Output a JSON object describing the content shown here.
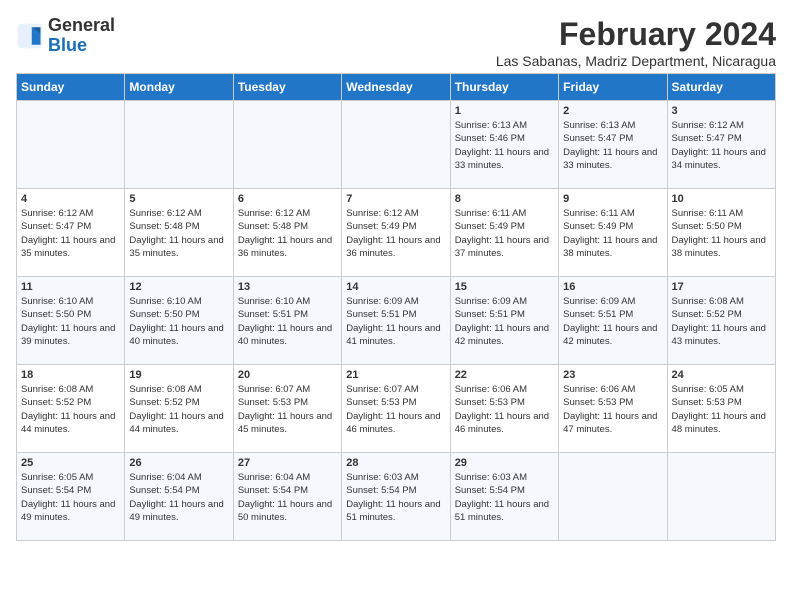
{
  "header": {
    "logo_general": "General",
    "logo_blue": "Blue",
    "month_year": "February 2024",
    "location": "Las Sabanas, Madriz Department, Nicaragua"
  },
  "columns": [
    "Sunday",
    "Monday",
    "Tuesday",
    "Wednesday",
    "Thursday",
    "Friday",
    "Saturday"
  ],
  "weeks": [
    [
      {
        "day": "",
        "info": ""
      },
      {
        "day": "",
        "info": ""
      },
      {
        "day": "",
        "info": ""
      },
      {
        "day": "",
        "info": ""
      },
      {
        "day": "1",
        "info": "Sunrise: 6:13 AM\nSunset: 5:46 PM\nDaylight: 11 hours and 33 minutes."
      },
      {
        "day": "2",
        "info": "Sunrise: 6:13 AM\nSunset: 5:47 PM\nDaylight: 11 hours and 33 minutes."
      },
      {
        "day": "3",
        "info": "Sunrise: 6:12 AM\nSunset: 5:47 PM\nDaylight: 11 hours and 34 minutes."
      }
    ],
    [
      {
        "day": "4",
        "info": "Sunrise: 6:12 AM\nSunset: 5:47 PM\nDaylight: 11 hours and 35 minutes."
      },
      {
        "day": "5",
        "info": "Sunrise: 6:12 AM\nSunset: 5:48 PM\nDaylight: 11 hours and 35 minutes."
      },
      {
        "day": "6",
        "info": "Sunrise: 6:12 AM\nSunset: 5:48 PM\nDaylight: 11 hours and 36 minutes."
      },
      {
        "day": "7",
        "info": "Sunrise: 6:12 AM\nSunset: 5:49 PM\nDaylight: 11 hours and 36 minutes."
      },
      {
        "day": "8",
        "info": "Sunrise: 6:11 AM\nSunset: 5:49 PM\nDaylight: 11 hours and 37 minutes."
      },
      {
        "day": "9",
        "info": "Sunrise: 6:11 AM\nSunset: 5:49 PM\nDaylight: 11 hours and 38 minutes."
      },
      {
        "day": "10",
        "info": "Sunrise: 6:11 AM\nSunset: 5:50 PM\nDaylight: 11 hours and 38 minutes."
      }
    ],
    [
      {
        "day": "11",
        "info": "Sunrise: 6:10 AM\nSunset: 5:50 PM\nDaylight: 11 hours and 39 minutes."
      },
      {
        "day": "12",
        "info": "Sunrise: 6:10 AM\nSunset: 5:50 PM\nDaylight: 11 hours and 40 minutes."
      },
      {
        "day": "13",
        "info": "Sunrise: 6:10 AM\nSunset: 5:51 PM\nDaylight: 11 hours and 40 minutes."
      },
      {
        "day": "14",
        "info": "Sunrise: 6:09 AM\nSunset: 5:51 PM\nDaylight: 11 hours and 41 minutes."
      },
      {
        "day": "15",
        "info": "Sunrise: 6:09 AM\nSunset: 5:51 PM\nDaylight: 11 hours and 42 minutes."
      },
      {
        "day": "16",
        "info": "Sunrise: 6:09 AM\nSunset: 5:51 PM\nDaylight: 11 hours and 42 minutes."
      },
      {
        "day": "17",
        "info": "Sunrise: 6:08 AM\nSunset: 5:52 PM\nDaylight: 11 hours and 43 minutes."
      }
    ],
    [
      {
        "day": "18",
        "info": "Sunrise: 6:08 AM\nSunset: 5:52 PM\nDaylight: 11 hours and 44 minutes."
      },
      {
        "day": "19",
        "info": "Sunrise: 6:08 AM\nSunset: 5:52 PM\nDaylight: 11 hours and 44 minutes."
      },
      {
        "day": "20",
        "info": "Sunrise: 6:07 AM\nSunset: 5:53 PM\nDaylight: 11 hours and 45 minutes."
      },
      {
        "day": "21",
        "info": "Sunrise: 6:07 AM\nSunset: 5:53 PM\nDaylight: 11 hours and 46 minutes."
      },
      {
        "day": "22",
        "info": "Sunrise: 6:06 AM\nSunset: 5:53 PM\nDaylight: 11 hours and 46 minutes."
      },
      {
        "day": "23",
        "info": "Sunrise: 6:06 AM\nSunset: 5:53 PM\nDaylight: 11 hours and 47 minutes."
      },
      {
        "day": "24",
        "info": "Sunrise: 6:05 AM\nSunset: 5:53 PM\nDaylight: 11 hours and 48 minutes."
      }
    ],
    [
      {
        "day": "25",
        "info": "Sunrise: 6:05 AM\nSunset: 5:54 PM\nDaylight: 11 hours and 49 minutes."
      },
      {
        "day": "26",
        "info": "Sunrise: 6:04 AM\nSunset: 5:54 PM\nDaylight: 11 hours and 49 minutes."
      },
      {
        "day": "27",
        "info": "Sunrise: 6:04 AM\nSunset: 5:54 PM\nDaylight: 11 hours and 50 minutes."
      },
      {
        "day": "28",
        "info": "Sunrise: 6:03 AM\nSunset: 5:54 PM\nDaylight: 11 hours and 51 minutes."
      },
      {
        "day": "29",
        "info": "Sunrise: 6:03 AM\nSunset: 5:54 PM\nDaylight: 11 hours and 51 minutes."
      },
      {
        "day": "",
        "info": ""
      },
      {
        "day": "",
        "info": ""
      }
    ]
  ]
}
